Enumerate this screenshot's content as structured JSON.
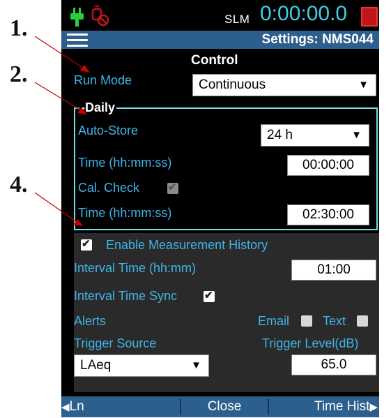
{
  "annotations": {
    "m1": "1.",
    "m2": "2.",
    "m4": "4."
  },
  "status": {
    "slm": "SLM",
    "timer": "0:00:00.0"
  },
  "header": {
    "title": "Settings: NMS044"
  },
  "control": {
    "heading": "Control",
    "run_mode_label": "Run Mode",
    "run_mode_value": "Continuous"
  },
  "daily": {
    "legend": "Daily",
    "autostore_label": "Auto-Store",
    "autostore_value": "24 h",
    "time1_label": "Time (hh:mm:ss)",
    "time1_value": "00:00:00",
    "cal_label": "Cal. Check",
    "time2_label": "Time (hh:mm:ss)",
    "time2_value": "02:30:00"
  },
  "history": {
    "enable_label": "Enable Measurement History",
    "interval_label": "Interval Time (hh:mm)",
    "interval_value": "01:00",
    "sync_label": "Interval Time Sync",
    "alerts_label": "Alerts",
    "email_label": "Email",
    "text_label": "Text",
    "trigger_source_label": "Trigger Source",
    "trigger_source_value": "LAeq",
    "trigger_level_label": "Trigger Level(dB)",
    "trigger_level_value": "65.0"
  },
  "footer": {
    "ln": "Ln",
    "close": "Close",
    "time_hist": "Time Hist"
  },
  "colors": {
    "accent": "#3fb4e8",
    "bar": "#2c5f8e",
    "timer": "#3fd0e8",
    "frame": "#73e0e6",
    "annotation_line": "#cc0000"
  }
}
